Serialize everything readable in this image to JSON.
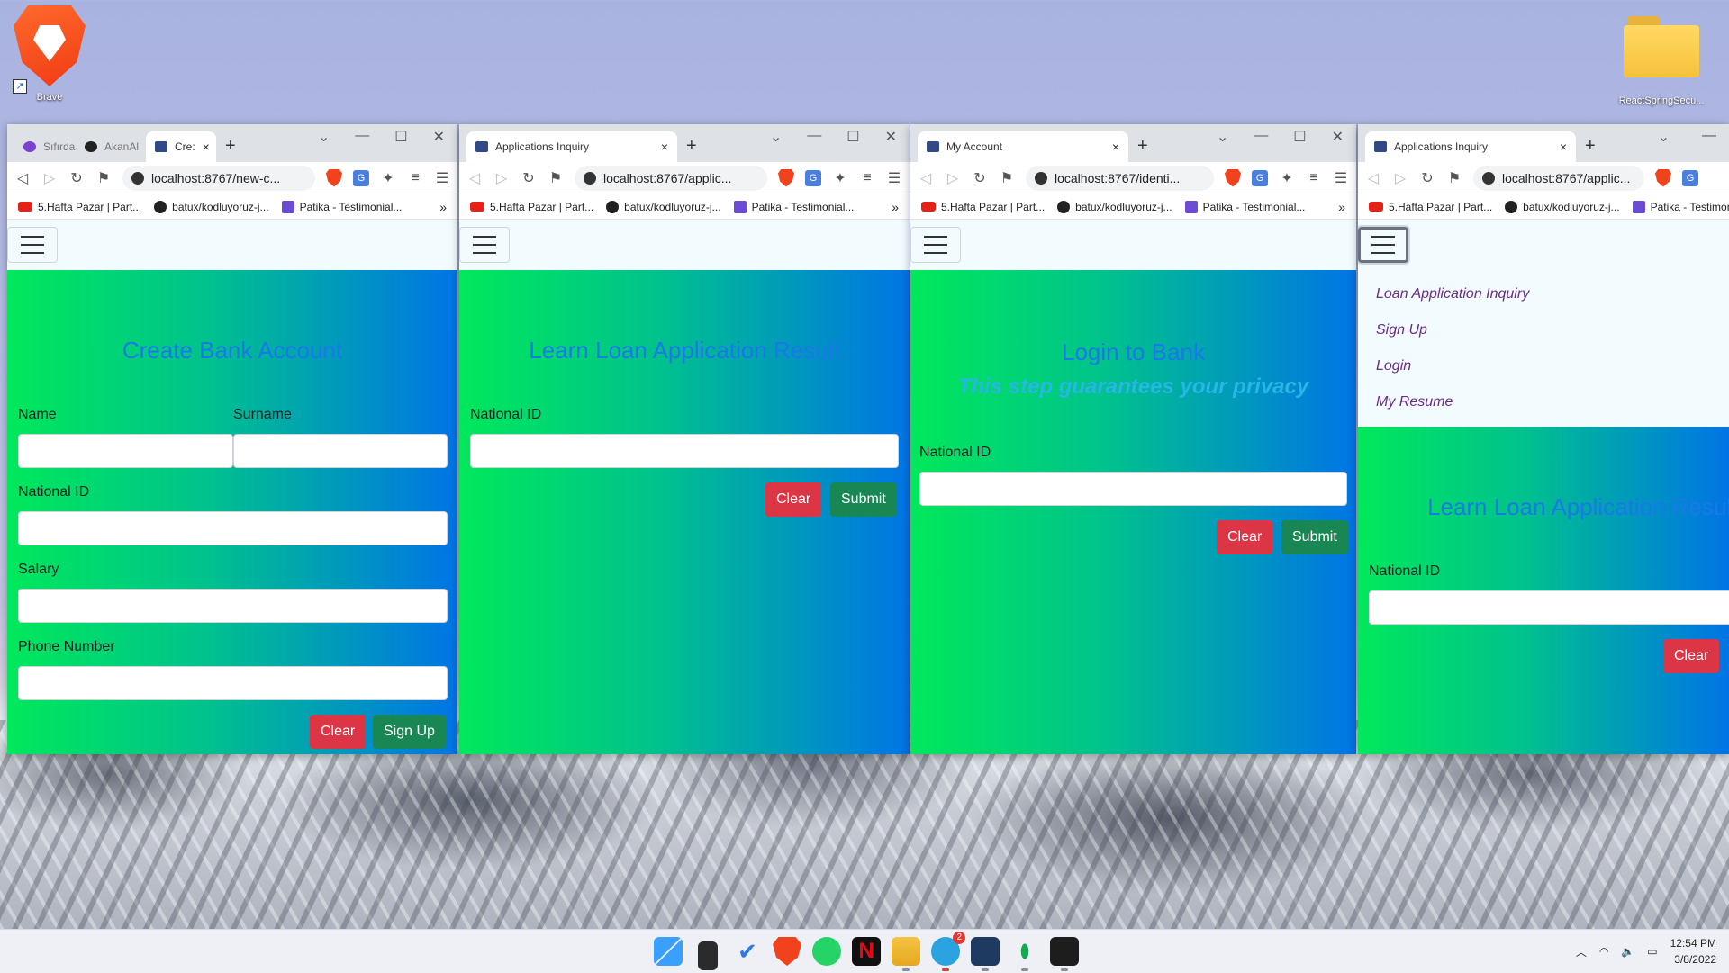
{
  "desktop": {
    "brave_label": "Brave",
    "folder_label": "ReactSpringSecu..."
  },
  "bookmarks": [
    {
      "label": "5.Hafta Pazar | Part...",
      "icon": "youtube-icon"
    },
    {
      "label": "batux/kodluyoruz-j...",
      "icon": "github-icon"
    },
    {
      "label": "Patika - Testimonial...",
      "icon": "patika-icon"
    }
  ],
  "windows": [
    {
      "tabs": [
        {
          "title": "Sıfırdan",
          "icon": "purple-circle-icon",
          "active": false
        },
        {
          "title": "AkanAl",
          "icon": "github-icon",
          "active": false
        },
        {
          "title": "Cre:",
          "icon": "page-icon",
          "active": true
        }
      ],
      "url": "localhost:8767/new-c...",
      "form": {
        "heading": "Create Bank Account",
        "name_label": "Name",
        "surname_label": "Surname",
        "national_id_label": "National ID",
        "salary_label": "Salary",
        "phone_label": "Phone Number",
        "clear_label": "Clear",
        "submit_label": "Sign Up"
      }
    },
    {
      "tabs": [
        {
          "title": "Applications Inquiry",
          "icon": "page-icon",
          "active": true
        }
      ],
      "url": "localhost:8767/applic...",
      "form": {
        "heading": "Learn Loan Application Result",
        "national_id_label": "National ID",
        "clear_label": "Clear",
        "submit_label": "Submit"
      }
    },
    {
      "tabs": [
        {
          "title": "My Account",
          "icon": "page-icon",
          "active": true
        }
      ],
      "url": "localhost:8767/identi...",
      "form": {
        "heading": "Login to Bank",
        "subheading": "This step guarantees your privacy",
        "national_id_label": "National ID",
        "clear_label": "Clear",
        "submit_label": "Submit"
      }
    },
    {
      "tabs": [
        {
          "title": "Applications Inquiry",
          "icon": "page-icon",
          "active": true
        }
      ],
      "url": "localhost:8767/applic...",
      "menu": [
        "Loan Application Inquiry",
        "Sign Up",
        "Login",
        "My Resume"
      ],
      "form": {
        "heading": "Learn Loan Application Result",
        "national_id_label": "National ID",
        "clear_label": "Clear"
      }
    }
  ],
  "taskbar": {
    "apps": [
      "windows-start-icon",
      "task-view-icon",
      "todo-icon",
      "brave-icon",
      "whatsapp-icon",
      "netflix-icon",
      "file-explorer-icon",
      "telegram-icon",
      "ide-icon",
      "mongodb-icon",
      "terminal-icon"
    ],
    "telegram_badge": "2",
    "time": "12:54 PM",
    "date": "3/8/2022"
  }
}
